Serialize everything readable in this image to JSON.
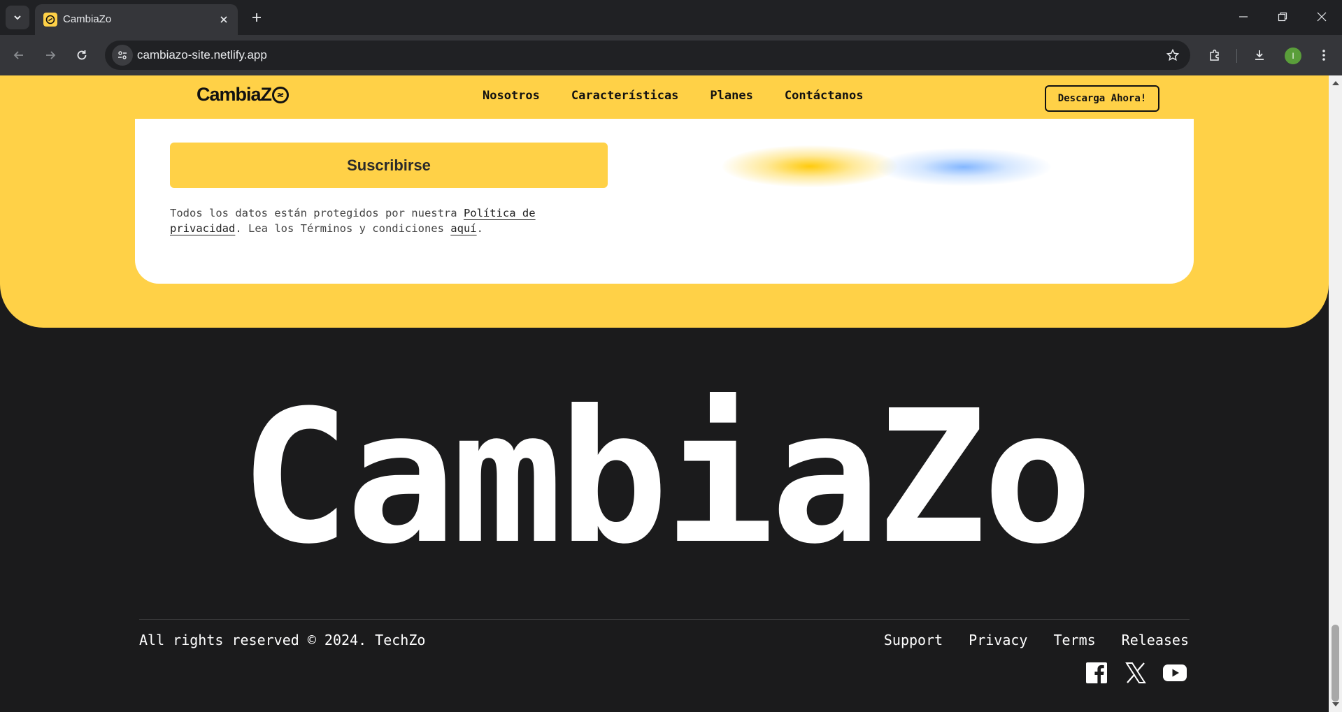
{
  "browser": {
    "tab_title": "CambiaZo",
    "url": "cambiazo-site.netlify.app",
    "profile_initial": "I"
  },
  "nav": {
    "logo_text": "CambiaZ",
    "links": [
      "Nosotros",
      "Características",
      "Planes",
      "Contáctanos"
    ],
    "cta": "Descarga Ahora!"
  },
  "subscribe": {
    "button_label": "Suscribirse",
    "note_prefix": "Todos los datos están protegidos por nuestra ",
    "privacy_link": "Política de privacidad",
    "note_middle": ". Lea los Términos y condiciones ",
    "terms_link": "aquí",
    "note_suffix": "."
  },
  "footer": {
    "brand": "CambiaZo",
    "copyright": "All rights reserved © 2024. TechZo",
    "links": [
      "Support",
      "Privacy",
      "Terms",
      "Releases"
    ],
    "social": [
      "facebook-icon",
      "x-icon",
      "youtube-icon"
    ]
  },
  "colors": {
    "brand_yellow": "#ffd147",
    "dark_bg": "#1b1b1c",
    "card_bg": "#ffffff"
  }
}
